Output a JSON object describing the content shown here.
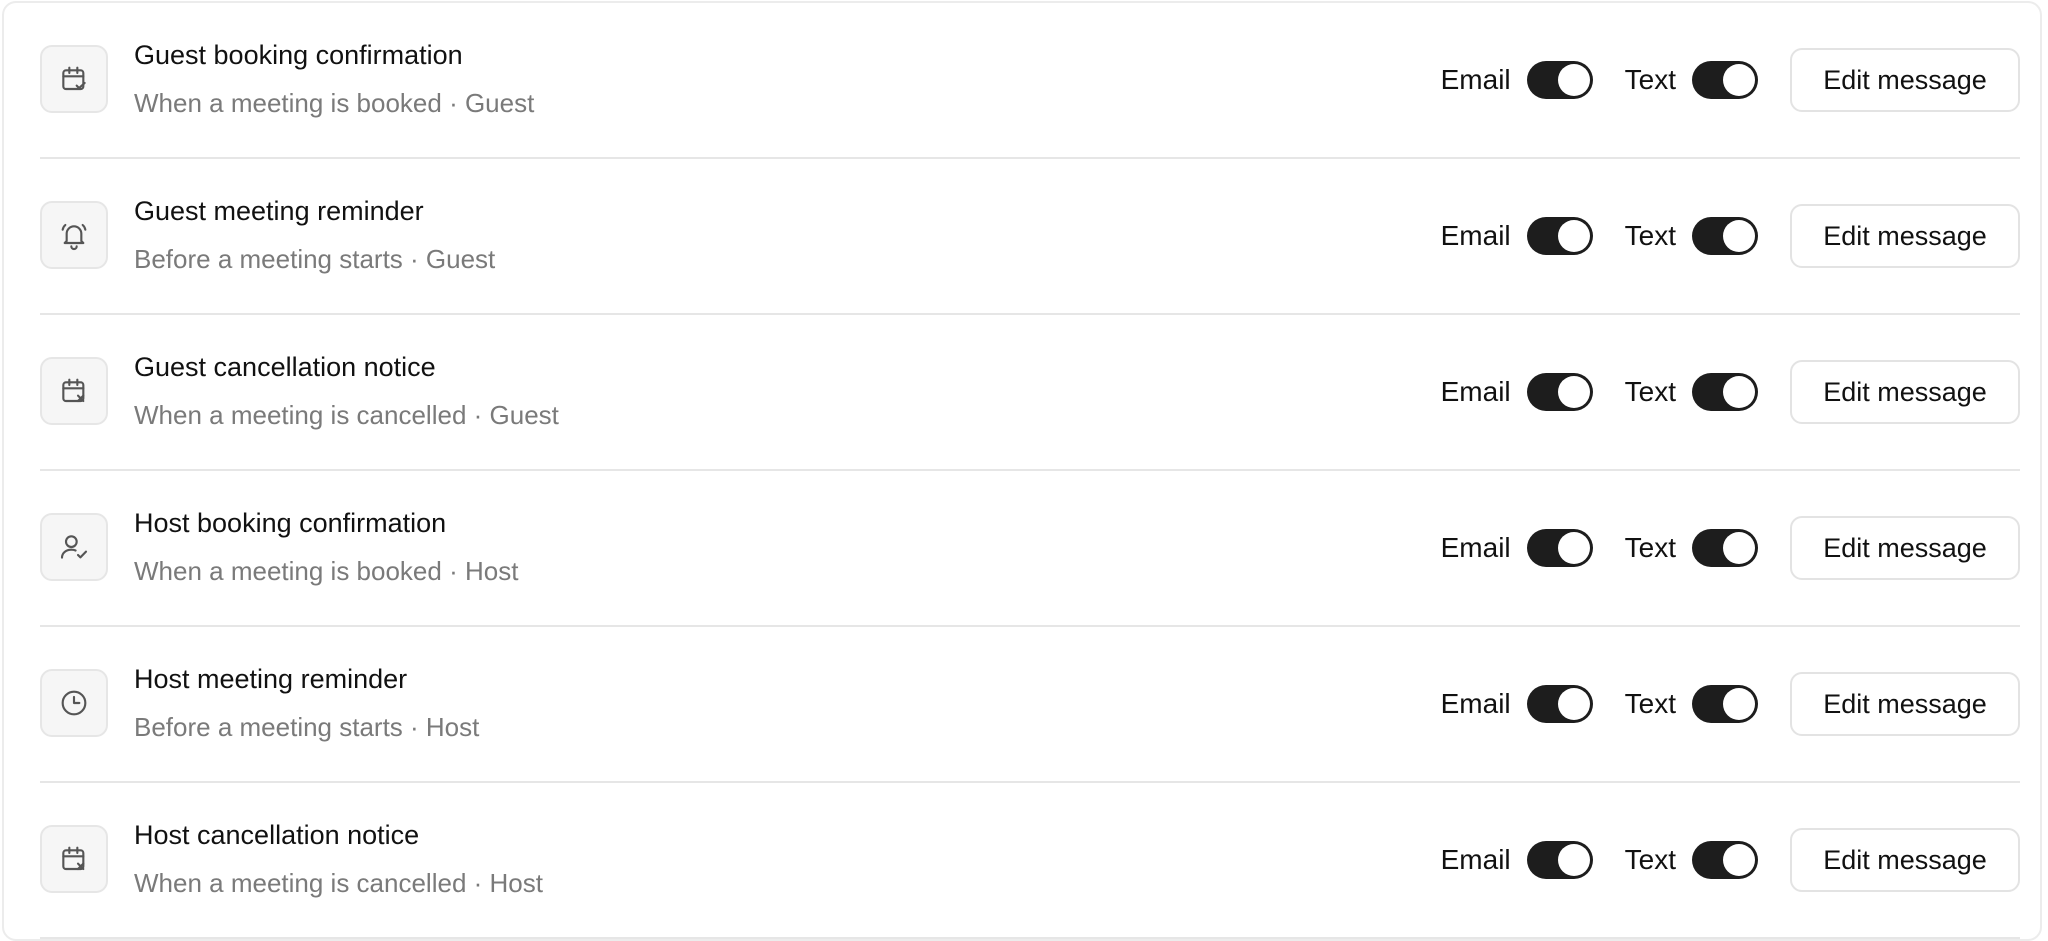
{
  "notifications": [
    {
      "icon": "calendar-check-icon",
      "title": "Guest booking confirmation",
      "subtitle": "When a meeting is booked · Guest",
      "email_label": "Email",
      "email_enabled": true,
      "text_label": "Text",
      "text_enabled": true,
      "edit_label": "Edit message"
    },
    {
      "icon": "bell-ringing-icon",
      "title": "Guest meeting reminder",
      "subtitle": "Before a meeting starts · Guest",
      "email_label": "Email",
      "email_enabled": true,
      "text_label": "Text",
      "text_enabled": true,
      "edit_label": "Edit message"
    },
    {
      "icon": "calendar-x-icon",
      "title": "Guest cancellation notice",
      "subtitle": "When a meeting is cancelled · Guest",
      "email_label": "Email",
      "email_enabled": true,
      "text_label": "Text",
      "text_enabled": true,
      "edit_label": "Edit message"
    },
    {
      "icon": "user-check-icon",
      "title": "Host booking confirmation",
      "subtitle": "When a meeting is booked · Host",
      "email_label": "Email",
      "email_enabled": true,
      "text_label": "Text",
      "text_enabled": true,
      "edit_label": "Edit message"
    },
    {
      "icon": "clock-icon",
      "title": "Host meeting reminder",
      "subtitle": "Before a meeting starts · Host",
      "email_label": "Email",
      "email_enabled": true,
      "text_label": "Text",
      "text_enabled": true,
      "edit_label": "Edit message"
    },
    {
      "icon": "calendar-x-icon",
      "title": "Host cancellation notice",
      "subtitle": "When a meeting is cancelled · Host",
      "email_label": "Email",
      "email_enabled": true,
      "text_label": "Text",
      "text_enabled": true,
      "edit_label": "Edit message"
    }
  ],
  "colors": {
    "toggle_on": "#1d1d1d",
    "subtitle": "#7a7a7a",
    "divider": "#e6e6e6"
  }
}
